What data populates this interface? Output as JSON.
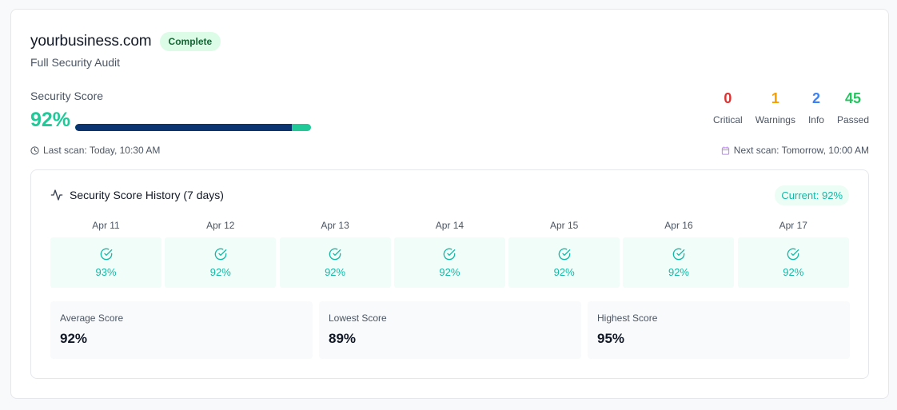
{
  "header": {
    "domain": "yourbusiness.com",
    "status_badge": "Complete",
    "subtitle": "Full Security Audit"
  },
  "score": {
    "label": "Security Score",
    "value_text": "92%",
    "progress": 0.92
  },
  "stats": [
    {
      "value": "0",
      "label": "Critical",
      "color": "#e03131"
    },
    {
      "value": "1",
      "label": "Warnings",
      "color": "#f59f00"
    },
    {
      "value": "2",
      "label": "Info",
      "color": "#3b82f6"
    },
    {
      "value": "45",
      "label": "Passed",
      "color": "#22c55e"
    }
  ],
  "scan": {
    "last": "Last scan: Today, 10:30 AM",
    "next": "Next scan: Tomorrow, 10:00 AM"
  },
  "history": {
    "title": "Security Score History (7 days)",
    "current_badge": "Current: 92%",
    "days": [
      {
        "date": "Apr 11",
        "value": "93%"
      },
      {
        "date": "Apr 12",
        "value": "92%"
      },
      {
        "date": "Apr 13",
        "value": "92%"
      },
      {
        "date": "Apr 14",
        "value": "92%"
      },
      {
        "date": "Apr 15",
        "value": "92%"
      },
      {
        "date": "Apr 16",
        "value": "92%"
      },
      {
        "date": "Apr 17",
        "value": "92%"
      }
    ],
    "summary": [
      {
        "label": "Average Score",
        "value": "92%"
      },
      {
        "label": "Lowest Score",
        "value": "89%"
      },
      {
        "label": "Highest Score",
        "value": "95%"
      }
    ]
  },
  "icons": {
    "clock": "clock-icon",
    "calendar": "calendar-icon",
    "activity": "activity-icon",
    "check": "check-circle-icon"
  },
  "colors": {
    "score_green": "#20c997",
    "progress_dark": "#0b3470",
    "teal": "#14b8a6",
    "calendar_purple": "#c084fc"
  }
}
